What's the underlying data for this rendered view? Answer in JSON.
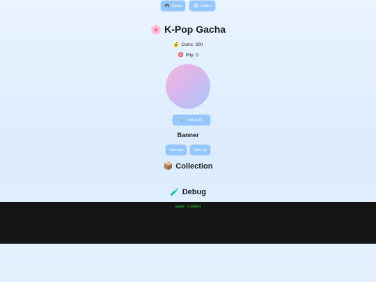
{
  "nav": {
    "items": [
      {
        "label": "Gacha",
        "icon": "game-controller-icon",
        "glyph": "🎮"
      },
      {
        "label": "Gallery",
        "icon": "frame-icon",
        "glyph": "🖼"
      }
    ]
  },
  "header": {
    "title": "K-Pop Gacha",
    "icon": "cherry-blossom-icon",
    "glyph": "🌸"
  },
  "stats": {
    "coins_label": "Coins: 300",
    "coins_glyph": "💰",
    "pity_label": "Pity: 0",
    "pity_glyph": "🎯"
  },
  "roll": {
    "label": "Roll (100)",
    "glyph": "🪄"
  },
  "banner": {
    "heading": "Banner",
    "options": [
      {
        "label": "Standard"
      },
      {
        "label": "Rate-Up"
      }
    ]
  },
  "collection": {
    "heading": "Collection",
    "glyph": "📦"
  },
  "debug": {
    "heading": "Debug",
    "glyph": "🧪",
    "log": "game loaded"
  },
  "colors": {
    "accent_button": "#93c7fd",
    "console_bg": "#141414",
    "console_text": "#22e022"
  }
}
